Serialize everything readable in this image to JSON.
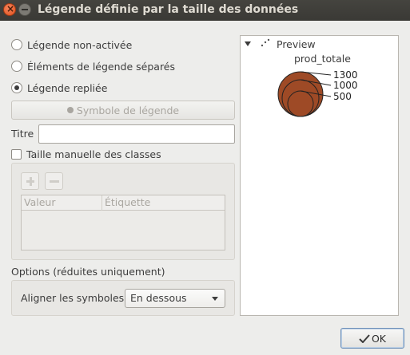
{
  "window": {
    "title": "Légende définie par la taille des données"
  },
  "legend_mode": {
    "options": [
      {
        "label": "Légende non-activée",
        "selected": false
      },
      {
        "label": "Éléments de légende séparés",
        "selected": false
      },
      {
        "label": "Légende repliée",
        "selected": true
      }
    ]
  },
  "symbol_button": {
    "label": "Symbole de légende"
  },
  "title_field": {
    "label": "Titre",
    "value": ""
  },
  "manual_classes": {
    "label": "Taille manuelle des classes",
    "checked": false
  },
  "classes_table": {
    "columns": [
      "Valeur",
      "Étiquette"
    ],
    "rows": []
  },
  "options": {
    "heading": "Options (réduites uniquement)",
    "align_label": "Aligner les symboles",
    "align_value": "En dessous"
  },
  "preview": {
    "root_label": "Preview",
    "field": "prod_totale",
    "classes": [
      "1300",
      "1000",
      "500"
    ],
    "fill_color": "#9e4a26",
    "stroke_color": "#222222"
  },
  "ok_button": {
    "label": "OK"
  }
}
